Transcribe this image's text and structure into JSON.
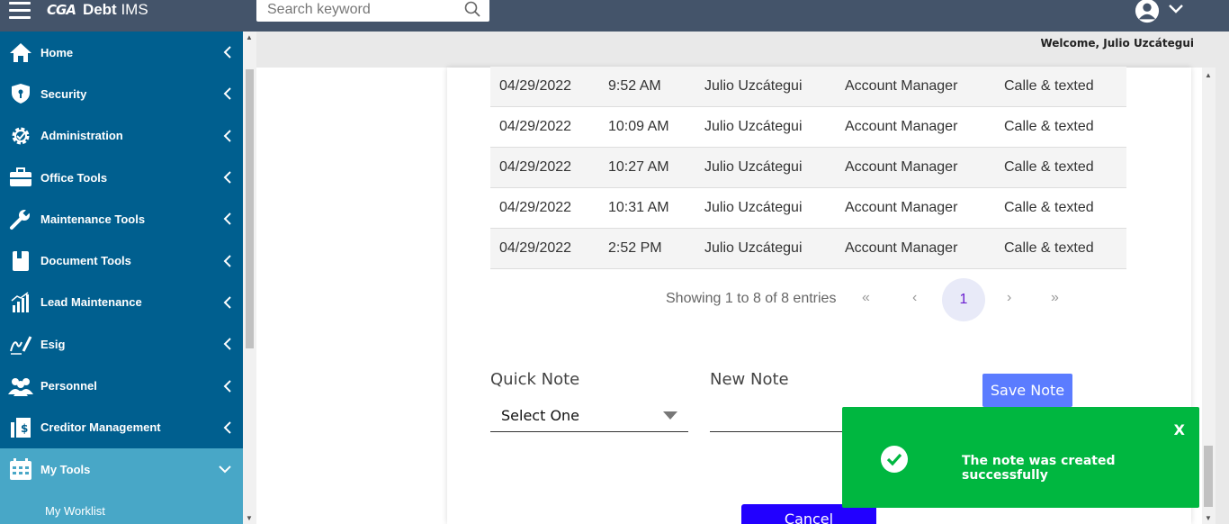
{
  "header": {
    "logo_mark": "CGA",
    "app_name_bold": "Debt",
    "app_name_rest": " IMS",
    "search_placeholder": "Search keyword"
  },
  "sidebar": {
    "items": [
      {
        "label": "Home",
        "icon": "home-icon"
      },
      {
        "label": "Security",
        "icon": "shield-icon"
      },
      {
        "label": "Administration",
        "icon": "gear-icon"
      },
      {
        "label": "Office Tools",
        "icon": "briefcase-icon"
      },
      {
        "label": "Maintenance Tools",
        "icon": "wrench-icon"
      },
      {
        "label": "Document Tools",
        "icon": "book-icon"
      },
      {
        "label": "Lead Maintenance",
        "icon": "chart-icon"
      },
      {
        "label": "Esig",
        "icon": "signature-icon"
      },
      {
        "label": "Personnel",
        "icon": "people-icon"
      },
      {
        "label": "Creditor Management",
        "icon": "ledger-icon"
      },
      {
        "label": "My Tools",
        "icon": "calendar-icon"
      }
    ],
    "sub_items": [
      "My Worklist"
    ]
  },
  "welcome": "Welcome, Julio Uzcátegui",
  "table": {
    "rows": [
      {
        "date": "04/29/2022",
        "time": "9:52 AM",
        "user": "Julio Uzcátegui",
        "role": "Account Manager",
        "note": "Calle & texted"
      },
      {
        "date": "04/29/2022",
        "time": "10:09 AM",
        "user": "Julio Uzcátegui",
        "role": "Account Manager",
        "note": "Calle & texted"
      },
      {
        "date": "04/29/2022",
        "time": "10:27 AM",
        "user": "Julio Uzcátegui",
        "role": "Account Manager",
        "note": "Calle & texted"
      },
      {
        "date": "04/29/2022",
        "time": "10:31 AM",
        "user": "Julio Uzcátegui",
        "role": "Account Manager",
        "note": "Calle & texted"
      },
      {
        "date": "04/29/2022",
        "time": "2:52 PM",
        "user": "Julio Uzcátegui",
        "role": "Account Manager",
        "note": "Calle & texted"
      }
    ]
  },
  "pager": {
    "info": "Showing 1 to 8 of 8 entries",
    "first": "«",
    "prev": "‹",
    "current": "1",
    "next": "›",
    "last": "»"
  },
  "form": {
    "quick_note_label": "Quick Note",
    "quick_note_value": "Select One",
    "new_note_label": "New Note",
    "save_label": "Save Note",
    "cancel_label": "Cancel"
  },
  "toast": {
    "close": "X",
    "message": "The note was created successfully"
  },
  "colors": {
    "topbar": "#44546a",
    "sidebar": "#005f8f",
    "sidebar_active": "#48a7c7",
    "toast": "#00b740",
    "save_button": "#5b7cff",
    "cancel_button": "#2200ff"
  }
}
